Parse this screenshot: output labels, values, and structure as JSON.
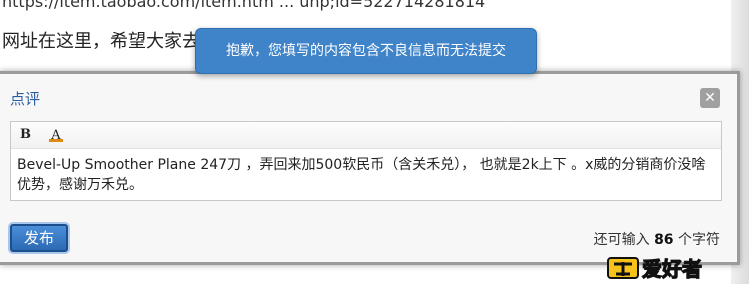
{
  "background": {
    "url_text": "https://item.taobao.com/item.htm ... uhp;id=522714281814",
    "sentence": "网址在这里，希望大家去"
  },
  "toast": {
    "message": "抱歉，您填写的内容包含不良信息而无法提交"
  },
  "dialog": {
    "title": "点评",
    "close_symbol": "✕",
    "toolbar": {
      "bold_label": "B",
      "color_label": "A"
    },
    "content": "Bevel-Up Smoother Plane 247刀 ，弄回来加500软民币（含关禾兑）， 也就是2k上下 。x威的分销商价没啥优势，感谢万禾兑。",
    "submit_label": "发布",
    "counter": {
      "prefix": "还可输入",
      "count": "86",
      "suffix": "个字符"
    }
  },
  "watermark": {
    "text": "爱好者",
    "colors": {
      "fill": "#e21b1b",
      "outline": "#111111",
      "accent": "#f7c21a"
    }
  }
}
